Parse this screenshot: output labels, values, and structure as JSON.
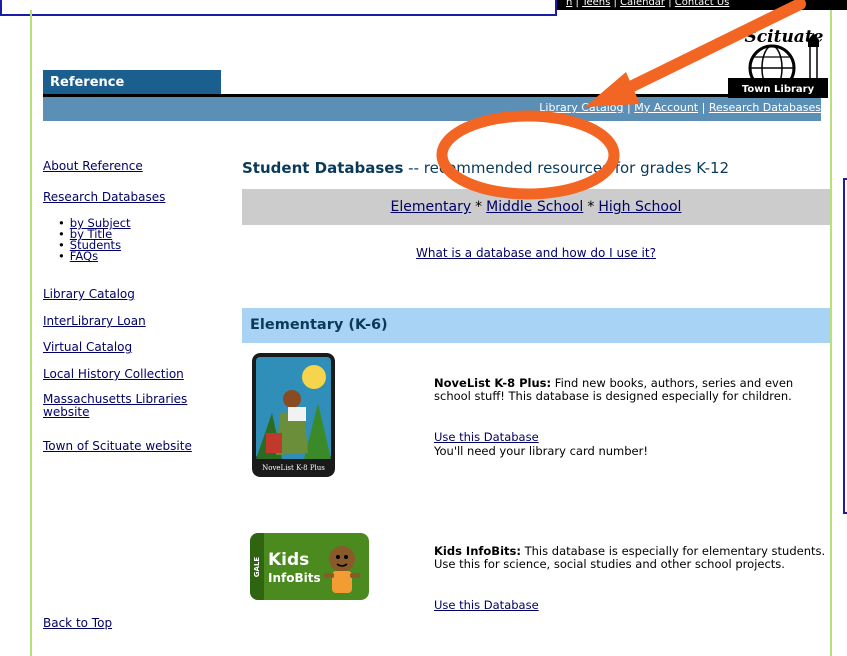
{
  "top_links": {
    "item1": "n",
    "item2": "Teens",
    "item3": "Calendar",
    "item4": "Contact Us",
    "separator": " | "
  },
  "header": {
    "section_title": "Reference",
    "logo_text_top": "Scituate",
    "logo_text_bottom": "Town Library",
    "nav_links": [
      "Library Catalog",
      "My Account",
      "Research Databases"
    ],
    "nav_separator": " | "
  },
  "sidebar": {
    "about": "About Reference",
    "research": "Research Databases",
    "sub_items": [
      "by Subject",
      "by Title",
      "Students",
      "FAQs"
    ],
    "library_catalog": "Library Catalog",
    "interlibrary": "InterLibrary Loan",
    "virtual": "Virtual Catalog",
    "local_history": "Local History Collection",
    "mass_libraries": "Massachusetts Libraries website",
    "town": "Town of Scituate website",
    "back_to_top": "Back to Top"
  },
  "main": {
    "heading_bold": "Student Databases",
    "heading_rest": " -- recommended resources for grades K-12",
    "grades": [
      "Elementary",
      "Middle School",
      "High School"
    ],
    "grade_separator": "*",
    "what_is_link": "What is a database and how do I use it?",
    "elementary_header": "Elementary (K-6)"
  },
  "products": [
    {
      "title": "NoveList K-8 Plus:",
      "description": " Find new books, authors, series and even school stuff! This database is designed especially for children.",
      "link": "Use this Database",
      "note": "You'll need your library card number!",
      "image_caption": "NoveList K-8 Plus"
    },
    {
      "title": "Kids InfoBits:",
      "description": " This database is especially for elementary students. Use this for science, social studies and other school projects.",
      "link": "Use this Database",
      "image_brand": "GALE",
      "image_word1": "Kids",
      "image_word2": "InfoBits"
    }
  ],
  "colors": {
    "tab_blue": "#1b5f8f",
    "bar_blue": "#5c8fb6",
    "section_light_blue": "#a9d3f5",
    "grade_gray": "#cccccc",
    "annotation_orange": "#f26522",
    "frame_green": "#b8e07a"
  }
}
